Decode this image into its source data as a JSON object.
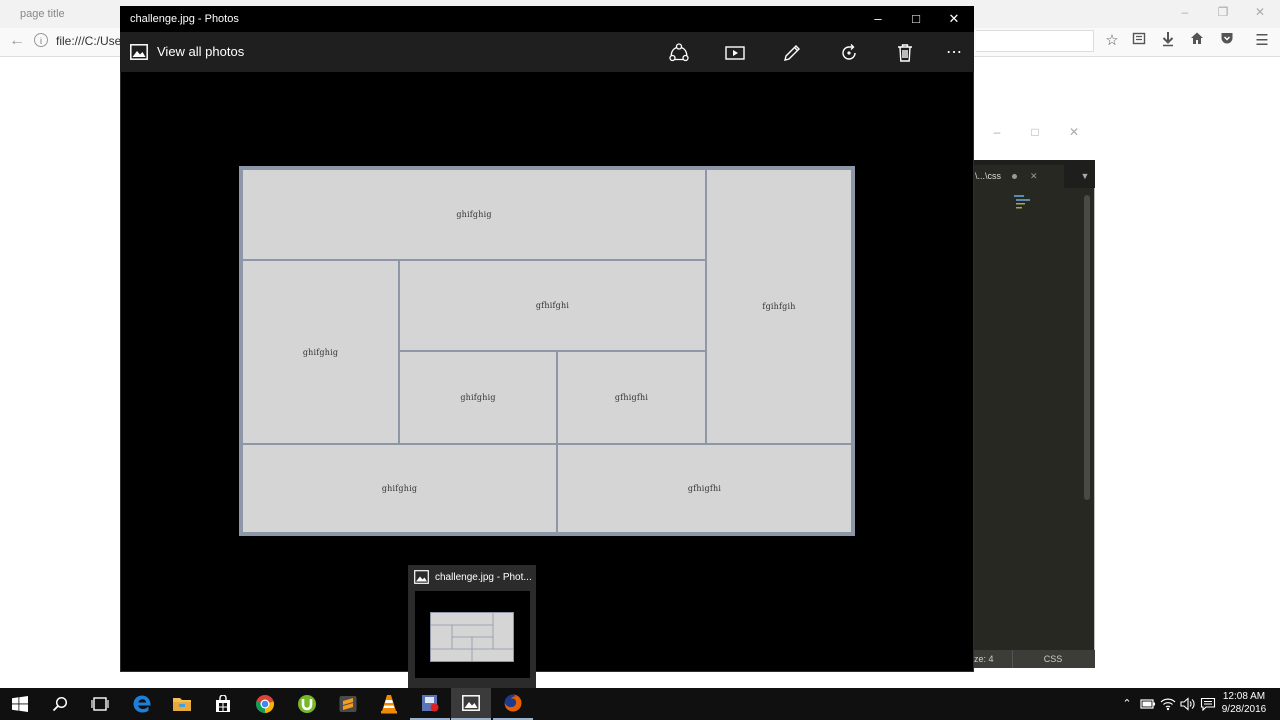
{
  "firefox": {
    "tab_title": "page title",
    "url": "file:///C:/Users/",
    "window_controls": [
      "minimize",
      "restore",
      "close"
    ],
    "toolbar_icons": [
      "star-icon",
      "reading-list-icon",
      "download-icon",
      "home-icon",
      "pocket-icon",
      "hamburger-menu-icon"
    ]
  },
  "editor": {
    "tab_label": "\\...\\css",
    "status_left": "ze: 4",
    "status_right": "CSS"
  },
  "photos": {
    "window_title": "challenge.jpg - Photos",
    "view_all_label": "View all photos",
    "toolbar_icons": [
      "share-icon",
      "slideshow-icon",
      "edit-pencil-icon",
      "rotate-icon",
      "delete-icon",
      "more-icon"
    ],
    "more_glyph": "⋯",
    "cells": {
      "top_wide": "ghifghig",
      "right_tall": "fgihfgih",
      "left_tall": "ghifghig",
      "middle_wide": "gfhifghi",
      "middle_small_left": "ghifghig",
      "middle_small_right": "gfhigfhi",
      "bottom_left": "ghifghig",
      "bottom_right": "gfhigfhi"
    }
  },
  "preview": {
    "title": "challenge.jpg - Phot..."
  },
  "taskbar": {
    "apps": [
      "start",
      "search",
      "task-view",
      "edge",
      "file-explorer",
      "store",
      "chrome",
      "utorrent",
      "sublime-text",
      "vlc",
      "app-installer",
      "photos",
      "firefox"
    ],
    "time": "12:08 AM",
    "date": "9/28/2016",
    "colors": {
      "edge": "#1e7fd8",
      "explorer": "#f2c14e",
      "chrome_red": "#db4437",
      "chrome_green": "#0f9d58",
      "chrome_yellow": "#f4b400",
      "utorrent": "#76b82a",
      "vlc": "#f08a00",
      "firefox": "#e66000",
      "photos_window_bg": "#000000",
      "canvas_fill": "#d5d5d5",
      "canvas_border": "#8e97a8"
    }
  }
}
